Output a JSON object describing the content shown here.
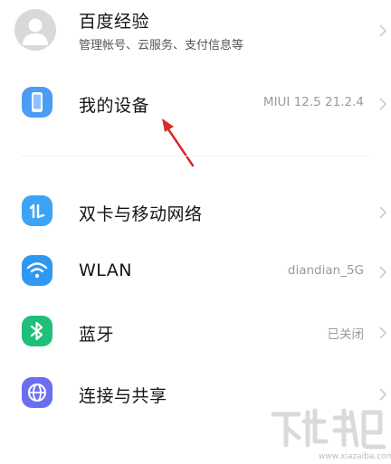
{
  "settings": {
    "items": [
      {
        "title": "百度经验",
        "subtitle": "管理帐号、云服务、支付信息等",
        "icon": "account-avatar"
      },
      {
        "title": "我的设备",
        "value": "MIUI 12.5 21.2.4",
        "icon": "phone-icon"
      },
      {
        "title": "双卡与移动网络",
        "icon": "sim-card-icon"
      },
      {
        "title": "WLAN",
        "value": "diandian_5G",
        "icon": "wifi-icon"
      },
      {
        "title": "蓝牙",
        "value": "已关闭",
        "icon": "bluetooth-icon"
      },
      {
        "title": "连接与共享",
        "icon": "connection-sharing-icon"
      }
    ]
  },
  "watermark": {
    "url": "www.xiazaiba.com"
  },
  "colors": {
    "title": "#141414",
    "subtitle": "#555555",
    "value": "#9a9a9a",
    "annotation_arrow": "#d62b2b"
  }
}
